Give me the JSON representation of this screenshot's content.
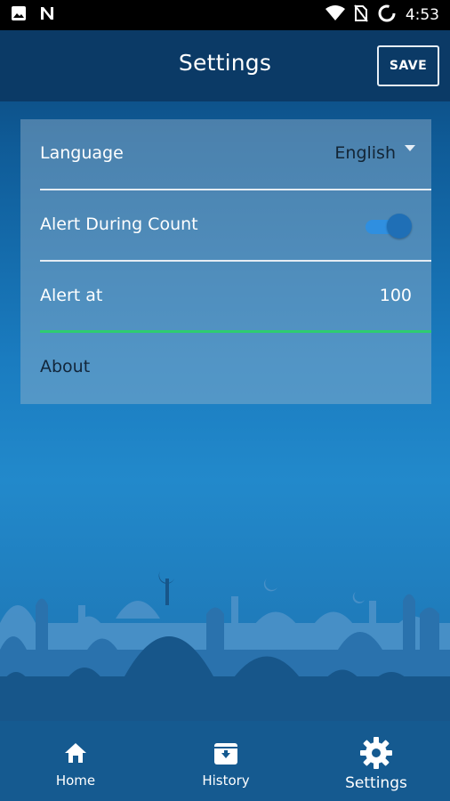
{
  "statusbar": {
    "time": "4:53",
    "icons": [
      "image-icon",
      "n-icon",
      "wifi-icon",
      "no-sim-icon",
      "loading-ring-icon"
    ]
  },
  "appbar": {
    "title": "Settings",
    "save_label": "SAVE"
  },
  "settings": {
    "language": {
      "label": "Language",
      "value": "English"
    },
    "alert_during_count": {
      "label": "Alert During Count",
      "enabled": true
    },
    "alert_at": {
      "label": "Alert at",
      "value": "100"
    },
    "about": {
      "label": "About"
    }
  },
  "bottom_nav": {
    "items": [
      {
        "label": "Home",
        "icon": "home-icon"
      },
      {
        "label": "History",
        "icon": "archive-icon"
      },
      {
        "label": "Settings",
        "icon": "gear-icon",
        "active": true
      }
    ]
  },
  "colors": {
    "appbar": "#0b3a66",
    "accent_green": "#2ecc71",
    "toggle_on": "#1f6fb6"
  }
}
